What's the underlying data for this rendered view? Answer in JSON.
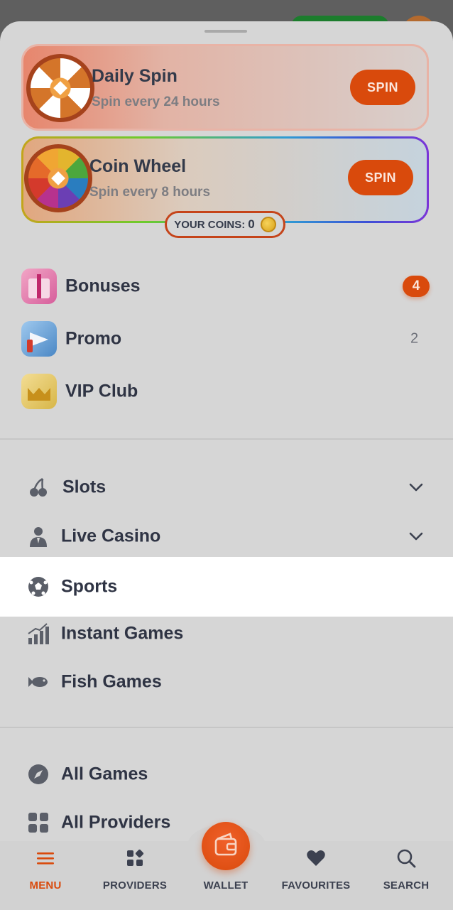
{
  "promos": {
    "daily_spin": {
      "title": "Daily Spin",
      "subtitle": "Spin every 24 hours",
      "button": "SPIN"
    },
    "coin_wheel": {
      "title": "Coin Wheel",
      "subtitle": "Spin every 8 hours",
      "button": "SPIN"
    },
    "coins": {
      "label": "YOUR COINS:",
      "value": "0"
    }
  },
  "rewards": {
    "bonuses": {
      "label": "Bonuses",
      "badge": "4"
    },
    "promo": {
      "label": "Promo",
      "count": "2"
    },
    "vip": {
      "label": "VIP Club"
    }
  },
  "games_nav": {
    "slots": "Slots",
    "live_casino": "Live Casino",
    "sports": "Sports",
    "instant_games": "Instant Games",
    "fish_games": "Fish Games"
  },
  "browse_nav": {
    "all_games": "All Games",
    "all_providers": "All Providers"
  },
  "bottom_nav": {
    "menu": "MENU",
    "providers": "PROVIDERS",
    "wallet": "WALLET",
    "favourites": "FAVOURITES",
    "search": "SEARCH"
  },
  "colors": {
    "accent": "#d94a0c",
    "text": "#2f3444",
    "active_tab": "#d94a0c",
    "highlight_row": "#ffffff"
  },
  "icons": {
    "bonuses": "gift-icon",
    "promo": "megaphone-icon",
    "vip": "crown-icon",
    "slots": "cherry-icon",
    "live_casino": "dealer-icon",
    "sports": "soccer-ball-icon",
    "instant_games": "bar-chart-rising-icon",
    "fish_games": "fish-icon",
    "all_games": "compass-icon",
    "all_providers": "grid-icon",
    "menu": "hamburger-icon",
    "providers": "providers-grid-icon",
    "wallet": "wallet-icon",
    "favourites": "heart-icon",
    "search": "search-icon"
  }
}
